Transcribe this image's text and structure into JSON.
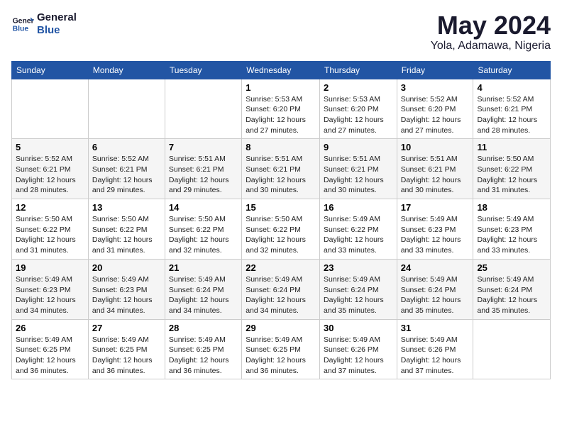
{
  "header": {
    "logo_line1": "General",
    "logo_line2": "Blue",
    "month": "May 2024",
    "location": "Yola, Adamawa, Nigeria"
  },
  "weekdays": [
    "Sunday",
    "Monday",
    "Tuesday",
    "Wednesday",
    "Thursday",
    "Friday",
    "Saturday"
  ],
  "weeks": [
    [
      {
        "day": "",
        "content": ""
      },
      {
        "day": "",
        "content": ""
      },
      {
        "day": "",
        "content": ""
      },
      {
        "day": "1",
        "content": "Sunrise: 5:53 AM\nSunset: 6:20 PM\nDaylight: 12 hours and 27 minutes."
      },
      {
        "day": "2",
        "content": "Sunrise: 5:53 AM\nSunset: 6:20 PM\nDaylight: 12 hours and 27 minutes."
      },
      {
        "day": "3",
        "content": "Sunrise: 5:52 AM\nSunset: 6:20 PM\nDaylight: 12 hours and 27 minutes."
      },
      {
        "day": "4",
        "content": "Sunrise: 5:52 AM\nSunset: 6:21 PM\nDaylight: 12 hours and 28 minutes."
      }
    ],
    [
      {
        "day": "5",
        "content": "Sunrise: 5:52 AM\nSunset: 6:21 PM\nDaylight: 12 hours and 28 minutes."
      },
      {
        "day": "6",
        "content": "Sunrise: 5:52 AM\nSunset: 6:21 PM\nDaylight: 12 hours and 29 minutes."
      },
      {
        "day": "7",
        "content": "Sunrise: 5:51 AM\nSunset: 6:21 PM\nDaylight: 12 hours and 29 minutes."
      },
      {
        "day": "8",
        "content": "Sunrise: 5:51 AM\nSunset: 6:21 PM\nDaylight: 12 hours and 30 minutes."
      },
      {
        "day": "9",
        "content": "Sunrise: 5:51 AM\nSunset: 6:21 PM\nDaylight: 12 hours and 30 minutes."
      },
      {
        "day": "10",
        "content": "Sunrise: 5:51 AM\nSunset: 6:21 PM\nDaylight: 12 hours and 30 minutes."
      },
      {
        "day": "11",
        "content": "Sunrise: 5:50 AM\nSunset: 6:22 PM\nDaylight: 12 hours and 31 minutes."
      }
    ],
    [
      {
        "day": "12",
        "content": "Sunrise: 5:50 AM\nSunset: 6:22 PM\nDaylight: 12 hours and 31 minutes."
      },
      {
        "day": "13",
        "content": "Sunrise: 5:50 AM\nSunset: 6:22 PM\nDaylight: 12 hours and 31 minutes."
      },
      {
        "day": "14",
        "content": "Sunrise: 5:50 AM\nSunset: 6:22 PM\nDaylight: 12 hours and 32 minutes."
      },
      {
        "day": "15",
        "content": "Sunrise: 5:50 AM\nSunset: 6:22 PM\nDaylight: 12 hours and 32 minutes."
      },
      {
        "day": "16",
        "content": "Sunrise: 5:49 AM\nSunset: 6:22 PM\nDaylight: 12 hours and 33 minutes."
      },
      {
        "day": "17",
        "content": "Sunrise: 5:49 AM\nSunset: 6:23 PM\nDaylight: 12 hours and 33 minutes."
      },
      {
        "day": "18",
        "content": "Sunrise: 5:49 AM\nSunset: 6:23 PM\nDaylight: 12 hours and 33 minutes."
      }
    ],
    [
      {
        "day": "19",
        "content": "Sunrise: 5:49 AM\nSunset: 6:23 PM\nDaylight: 12 hours and 34 minutes."
      },
      {
        "day": "20",
        "content": "Sunrise: 5:49 AM\nSunset: 6:23 PM\nDaylight: 12 hours and 34 minutes."
      },
      {
        "day": "21",
        "content": "Sunrise: 5:49 AM\nSunset: 6:24 PM\nDaylight: 12 hours and 34 minutes."
      },
      {
        "day": "22",
        "content": "Sunrise: 5:49 AM\nSunset: 6:24 PM\nDaylight: 12 hours and 34 minutes."
      },
      {
        "day": "23",
        "content": "Sunrise: 5:49 AM\nSunset: 6:24 PM\nDaylight: 12 hours and 35 minutes."
      },
      {
        "day": "24",
        "content": "Sunrise: 5:49 AM\nSunset: 6:24 PM\nDaylight: 12 hours and 35 minutes."
      },
      {
        "day": "25",
        "content": "Sunrise: 5:49 AM\nSunset: 6:24 PM\nDaylight: 12 hours and 35 minutes."
      }
    ],
    [
      {
        "day": "26",
        "content": "Sunrise: 5:49 AM\nSunset: 6:25 PM\nDaylight: 12 hours and 36 minutes."
      },
      {
        "day": "27",
        "content": "Sunrise: 5:49 AM\nSunset: 6:25 PM\nDaylight: 12 hours and 36 minutes."
      },
      {
        "day": "28",
        "content": "Sunrise: 5:49 AM\nSunset: 6:25 PM\nDaylight: 12 hours and 36 minutes."
      },
      {
        "day": "29",
        "content": "Sunrise: 5:49 AM\nSunset: 6:25 PM\nDaylight: 12 hours and 36 minutes."
      },
      {
        "day": "30",
        "content": "Sunrise: 5:49 AM\nSunset: 6:26 PM\nDaylight: 12 hours and 37 minutes."
      },
      {
        "day": "31",
        "content": "Sunrise: 5:49 AM\nSunset: 6:26 PM\nDaylight: 12 hours and 37 minutes."
      },
      {
        "day": "",
        "content": ""
      }
    ]
  ]
}
